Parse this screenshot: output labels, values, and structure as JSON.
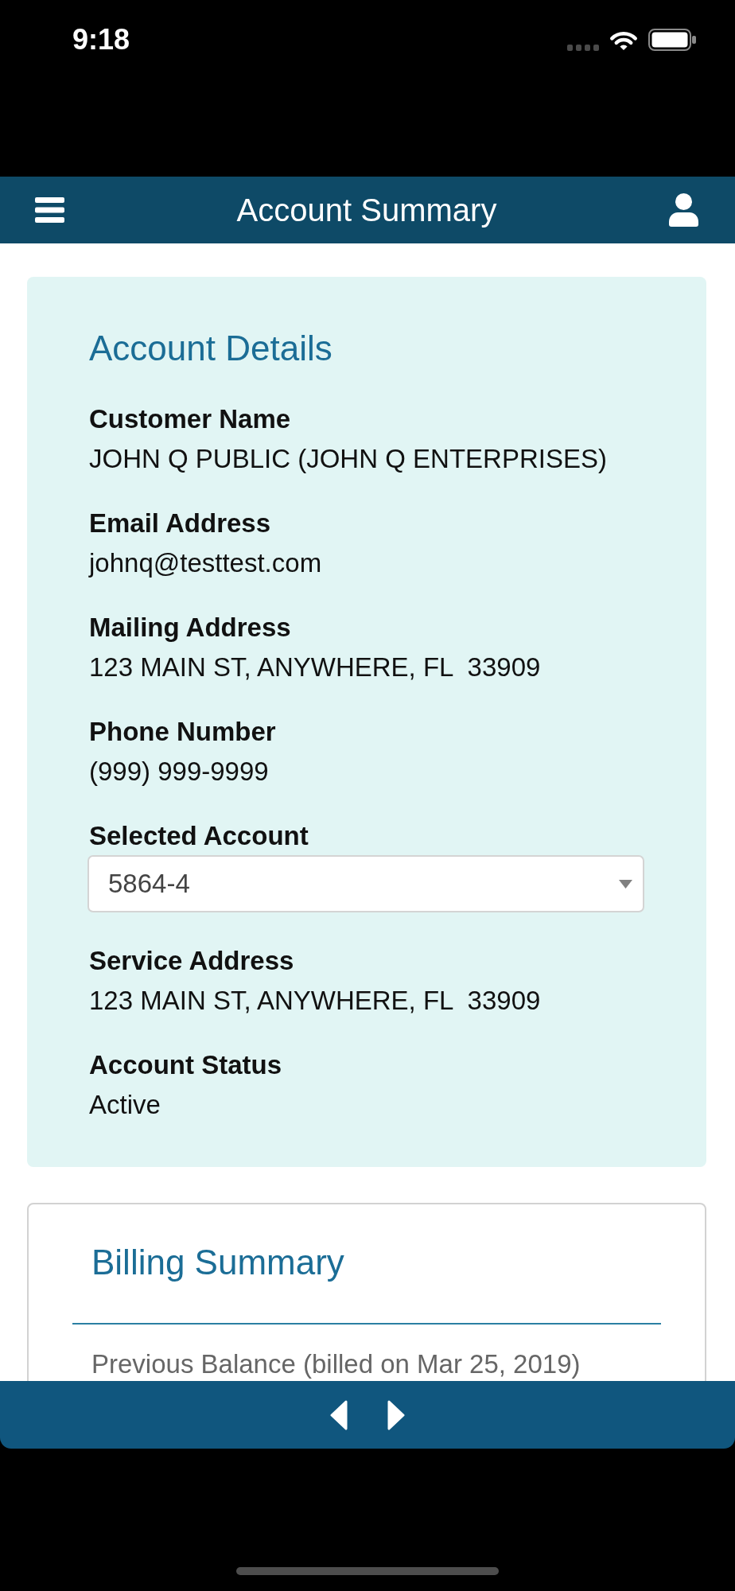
{
  "status_bar": {
    "time": "9:18"
  },
  "header": {
    "title": "Account Summary"
  },
  "account_details": {
    "title": "Account Details",
    "fields": [
      {
        "kind": "text",
        "label": "Customer Name",
        "value": "JOHN Q PUBLIC (JOHN Q ENTERPRISES)"
      },
      {
        "kind": "text",
        "label": "Email Address",
        "value": "johnq@testtest.com"
      },
      {
        "kind": "text",
        "label": "Mailing Address",
        "value": "123 MAIN ST, ANYWHERE, FL  33909"
      },
      {
        "kind": "text",
        "label": "Phone Number",
        "value": "(999) 999-9999"
      },
      {
        "kind": "select",
        "label": "Selected Account",
        "value": "5864-4"
      },
      {
        "kind": "text",
        "label": "Service Address",
        "value": "123 MAIN ST, ANYWHERE, FL  33909"
      },
      {
        "kind": "text",
        "label": "Account Status",
        "value": "Active"
      }
    ]
  },
  "billing_summary": {
    "title": "Billing Summary",
    "rows": [
      {
        "label": "Previous Balance (billed on Mar 25, 2019)"
      }
    ]
  }
}
